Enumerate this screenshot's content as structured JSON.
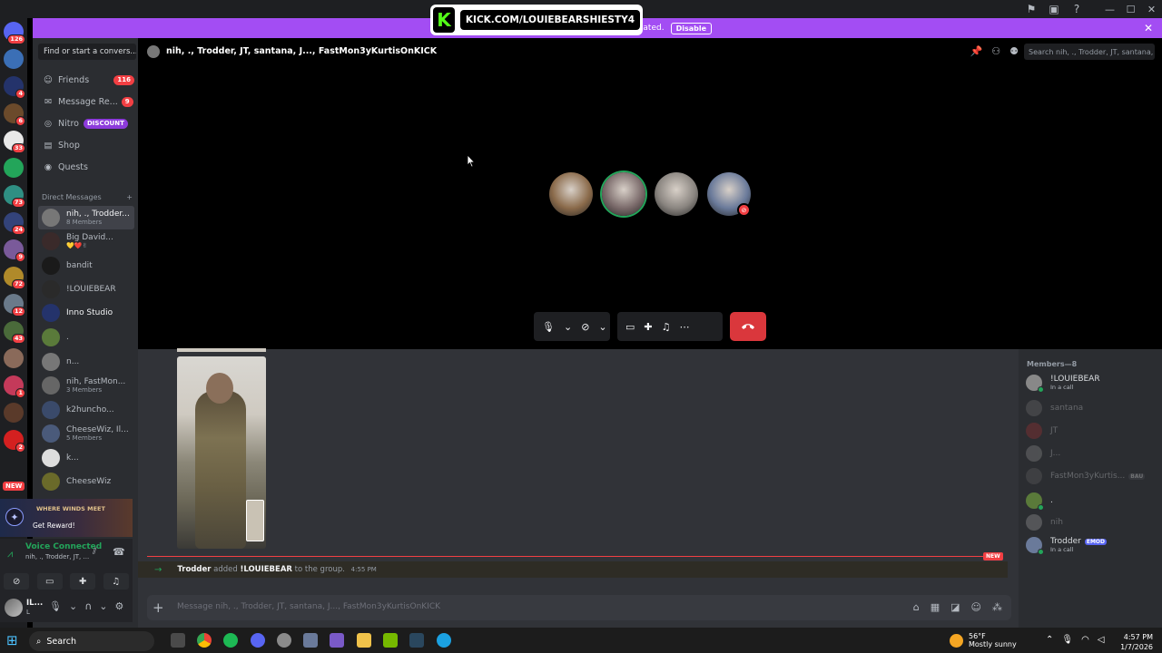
{
  "banner": {
    "text": "uncated.",
    "disable_label": "Disable"
  },
  "overlay": {
    "url": "KICK.COM/LOUIEBEARSHIESTY4",
    "logo_letter": "K"
  },
  "rail": {
    "servers": [
      {
        "badge": "126",
        "color": "#5865f2"
      },
      {
        "badge": "",
        "color": "#3b6fb6"
      },
      {
        "badge": "4",
        "color": "#24336b"
      },
      {
        "badge": "6",
        "color": "#6b4a2b"
      },
      {
        "badge": "33",
        "color": "#e8e8e8"
      },
      {
        "badge": "",
        "color": "#23a55a"
      },
      {
        "badge": "73",
        "color": "#2f8f83"
      },
      {
        "badge": "24",
        "color": "#33437a"
      },
      {
        "badge": "9",
        "color": "#7a5a9a"
      },
      {
        "badge": "72",
        "color": "#b08a2a"
      },
      {
        "badge": "12",
        "color": "#6a7a8a"
      },
      {
        "badge": "43",
        "color": "#4a6a3a"
      },
      {
        "badge": "",
        "color": "#8a6a5a"
      },
      {
        "badge": "1",
        "color": "#c43a5a"
      },
      {
        "badge": "",
        "color": "#5a3a2a"
      },
      {
        "badge": "2",
        "color": "#d42020"
      }
    ],
    "new_label": "NEW"
  },
  "sidebar": {
    "find_placeholder": "Find or start a convers...",
    "nav": [
      {
        "label": "Friends",
        "badge": "116"
      },
      {
        "label": "Message Re...",
        "badge": "9"
      },
      {
        "label": "Nitro",
        "badge": "DISCOUNT"
      },
      {
        "label": "Shop",
        "badge": ""
      },
      {
        "label": "Quests",
        "badge": ""
      }
    ],
    "dm_header": "Direct Messages",
    "dms": [
      {
        "name": "nih, ., Trodder...",
        "sub": "8 Members",
        "color": "#777"
      },
      {
        "name": "Big David...",
        "sub": "💛❤️✌",
        "color": "#3a2a2a"
      },
      {
        "name": "bandit",
        "sub": "",
        "color": "#1a1a1a"
      },
      {
        "name": "!LOUIEBEAR",
        "sub": "",
        "color": "#2a2a2a"
      },
      {
        "name": "Inno Studio",
        "sub": "",
        "color": "#24336b"
      },
      {
        "name": ".",
        "sub": "",
        "color": "#5a7a3a"
      },
      {
        "name": "n...",
        "sub": "",
        "color": "#777"
      },
      {
        "name": "nih, FastMon...",
        "sub": "3 Members",
        "color": "#666"
      },
      {
        "name": "k2huncho...",
        "sub": "",
        "color": "#3a4a6a"
      },
      {
        "name": "CheeseWiz, Il...",
        "sub": "5 Members",
        "color": "#4a5a7a"
      },
      {
        "name": "k...",
        "sub": "",
        "color": "#ddd"
      },
      {
        "name": "CheeseWiz",
        "sub": "",
        "color": "#6a6a2a"
      }
    ],
    "promo": {
      "game": "WHERE WINDS MEET",
      "reward": "Get Reward!"
    },
    "voice": {
      "status": "Voice Connected",
      "channel": "nih, ., Trodder, JT, ..."
    },
    "user": {
      "name": "IL...",
      "sub": "L"
    }
  },
  "call": {
    "title": "nih, ., Trodder, JT, santana, J..., FastMon3yKurtisOnKICK",
    "search_placeholder": "Search nih, ., Trodder, JT, santana, ...",
    "participants": [
      {
        "color": "#8a6a4a",
        "speaking": false
      },
      {
        "color": "#7a6a6a",
        "speaking": true
      },
      {
        "color": "#8a8580",
        "speaking": false
      },
      {
        "color": "#6a7a9a",
        "speaking": false
      }
    ]
  },
  "chat": {
    "system_actor": "Trodder",
    "system_text": "added",
    "system_target": "!LOUIEBEAR",
    "system_suffix": "to the group.",
    "system_time": "4:55 PM",
    "new_label": "NEW",
    "composer_placeholder": "Message nih, ., Trodder, JT, santana, J..., FastMon3yKurtisOnKICK"
  },
  "members": {
    "header": "Members—8",
    "list": [
      {
        "name": "!LOUIEBEAR",
        "sub": "In a call",
        "tag": "",
        "dim": false,
        "color": "#888"
      },
      {
        "name": "santana",
        "sub": "",
        "tag": "",
        "dim": true,
        "color": "#777"
      },
      {
        "name": "JT",
        "sub": "",
        "tag": "",
        "dim": true,
        "color": "#a33"
      },
      {
        "name": "J...",
        "sub": "",
        "tag": "",
        "dim": true,
        "color": "#999"
      },
      {
        "name": "FastMon3yKurtis...",
        "sub": "",
        "tag": "BAU",
        "dim": true,
        "color": "#666"
      },
      {
        "name": ".",
        "sub": "",
        "tag": "",
        "dim": false,
        "color": "#5a7a3a"
      },
      {
        "name": "nih",
        "sub": "",
        "tag": "",
        "dim": true,
        "color": "#aaa"
      },
      {
        "name": "Trodder",
        "sub": "In a call",
        "tag": "EMOD",
        "dim": false,
        "color": "#6a7a9a"
      }
    ]
  },
  "taskbar": {
    "search_label": "Search",
    "weather_temp": "56°F",
    "weather_desc": "Mostly sunny",
    "time": "4:57 PM",
    "date": "1/7/2026"
  }
}
